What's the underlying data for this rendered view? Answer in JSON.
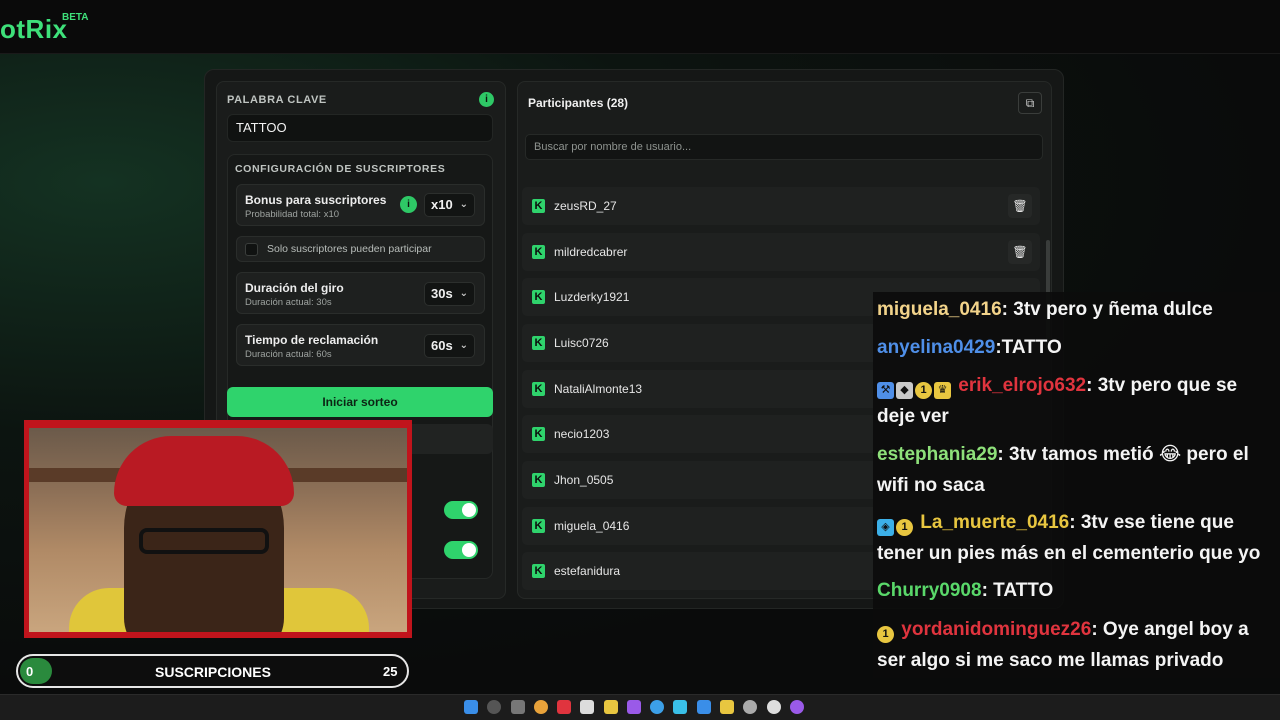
{
  "app": {
    "logo": "otRix",
    "beta": "BETA"
  },
  "keyword": {
    "title": "PALABRA CLAVE",
    "value": "TATTOO"
  },
  "subs_config": {
    "title": "CONFIGURACIÓN DE SUSCRIPTORES",
    "bonus": {
      "label": "Bonus para suscriptores",
      "sub": "Probabilidad total: x10",
      "value": "x10"
    },
    "only_subs": {
      "label": "Solo suscriptores pueden participar"
    },
    "spin": {
      "label": "Duración del giro",
      "sub": "Duración actual: 30s",
      "value": "30s"
    },
    "claim": {
      "label": "Tiempo de reclamación",
      "sub": "Duración actual: 60s",
      "value": "60s"
    }
  },
  "start_label": "Iniciar sorteo",
  "participants": {
    "title": "Participantes (28)",
    "search_placeholder": "Buscar por nombre de usuario...",
    "rows": [
      "zeusRD_27",
      "mildredcabrer",
      "Luzderky1921",
      "Luisc0726",
      "NataliAlmonte13",
      "necio1203",
      "Jhon_0505",
      "miguela_0416",
      "estefanidura"
    ]
  },
  "sub_bar": {
    "current": "0",
    "label": "SUSCRIPCIONES",
    "goal": "25",
    "progress_fraction": 0
  },
  "chat": [
    {
      "user": "miguela_0416",
      "color": "#f2d38a",
      "text": ": 3tv pero y ñema dulce"
    },
    {
      "user": "anyelina0429",
      "color": "#4f8fe8",
      "text": ":TATTO"
    },
    {
      "user": "erik_elrojo632",
      "color": "#e0343e",
      "text": ": 3tv pero que se deje ver"
    },
    {
      "user": "estephania29",
      "color": "#8ee07a",
      "text": ": 3tv tamos metió 😂 pero el wifi no saca"
    },
    {
      "user": "La_muerte_0416",
      "color": "#e8c640",
      "text": ": 3tv ese tiene que tener un pies más en el cementerio que yo"
    },
    {
      "user": "Churry0908",
      "color": "#5ad86a",
      "text": ": TATTO"
    },
    {
      "user": "yordanidominguez26",
      "color": "#e0343e",
      "text": ": Oye angel boy a ser algo si me saco me llamas privado"
    }
  ],
  "colors": {
    "accent": "#2fd36c",
    "panel": "#1a1c1b",
    "frame_red": "#c0141c"
  },
  "icons": {
    "info": "info-icon",
    "copy": "copy-icon",
    "trash": "trash-icon",
    "kick": "kick-icon",
    "chevron": "chevron-down-icon"
  }
}
